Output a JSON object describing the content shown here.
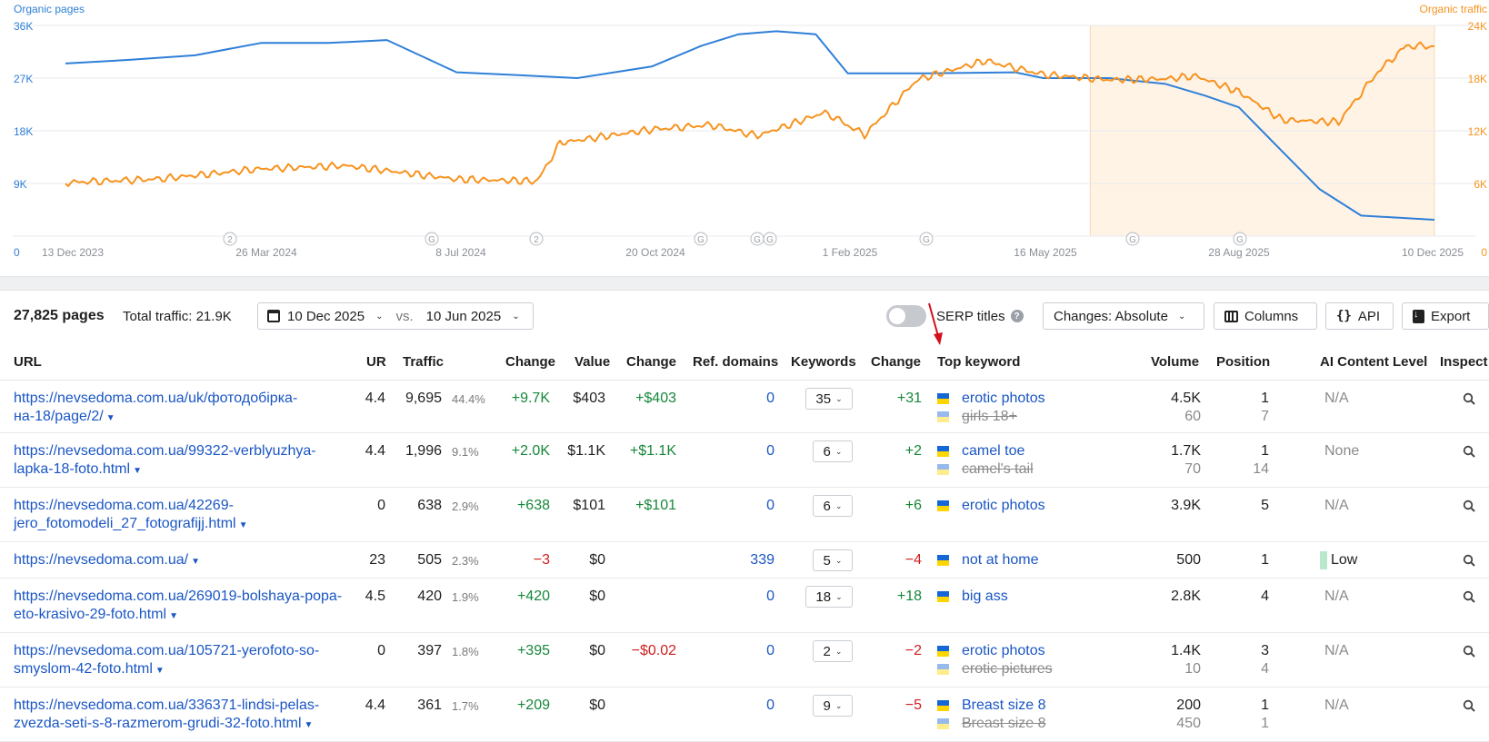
{
  "chart": {
    "left_label": "Organic pages",
    "right_label": "Organic traffic",
    "left_ticks": [
      "36K",
      "27K",
      "18K",
      "9K",
      "0"
    ],
    "right_ticks": [
      "24K",
      "18K",
      "12K",
      "6K",
      "0"
    ],
    "x_ticks": [
      "13 Dec 2023",
      "26 Mar 2024",
      "8 Jul 2024",
      "20 Oct 2024",
      "1 Feb 2025",
      "16 May 2025",
      "28 Aug 2025",
      "10 Dec 2025"
    ],
    "markers": [
      "2",
      "G",
      "2",
      "G",
      "G",
      "G",
      "G",
      "G",
      "G"
    ],
    "colors": {
      "pages": "#2f7fd8",
      "traffic": "#f7931e",
      "highlight": "#fff3e6"
    }
  },
  "chart_data": {
    "type": "line",
    "x_range": [
      "13 Dec 2023",
      "10 Dec 2025"
    ],
    "series": [
      {
        "name": "Organic pages",
        "axis": "left",
        "ylim": [
          0,
          36000
        ],
        "x": [
          "2023-12-13",
          "2024-01-15",
          "2024-02-20",
          "2024-03-26",
          "2024-05-01",
          "2024-06-01",
          "2024-07-08",
          "2024-08-10",
          "2024-09-10",
          "2024-10-20",
          "2024-11-15",
          "2024-12-05",
          "2024-12-25",
          "2025-01-15",
          "2025-02-01",
          "2025-03-15",
          "2025-05-01",
          "2025-05-16",
          "2025-06-20",
          "2025-07-20",
          "2025-08-10",
          "2025-08-28",
          "2025-09-20",
          "2025-10-10",
          "2025-11-01",
          "2025-12-10"
        ],
        "values": [
          29500,
          30100,
          30900,
          33000,
          33000,
          33500,
          28000,
          27500,
          27000,
          29000,
          32500,
          34500,
          35000,
          34500,
          27800,
          27800,
          28000,
          27000,
          27000,
          26000,
          24000,
          22000,
          14500,
          8000,
          3500,
          2800
        ]
      },
      {
        "name": "Organic traffic",
        "axis": "right",
        "ylim": [
          0,
          24000
        ],
        "x": [
          "2023-12-13",
          "2024-02-01",
          "2024-03-26",
          "2024-05-10",
          "2024-07-08",
          "2024-08-20",
          "2024-09-01",
          "2024-10-20",
          "2024-11-20",
          "2024-12-15",
          "2025-01-20",
          "2025-02-10",
          "2025-03-10",
          "2025-04-15",
          "2025-05-16",
          "2025-06-20",
          "2025-07-20",
          "2025-08-05",
          "2025-08-28",
          "2025-09-20",
          "2025-10-20",
          "2025-11-10",
          "2025-11-25",
          "2025-12-10"
        ],
        "values": [
          6100,
          6300,
          7400,
          8000,
          6700,
          6500,
          10700,
          11800,
          12200,
          11300,
          14500,
          12000,
          18100,
          19500,
          17700,
          17500,
          18300,
          19000,
          16800,
          13000,
          12500,
          18300,
          22000,
          22500
        ]
      }
    ]
  },
  "toolbar": {
    "pages": "27,825 pages",
    "total_traffic": "Total traffic: 21.9K",
    "date1": "10 Dec 2025",
    "vs": "vs.",
    "date2": "10 Jun 2025",
    "serp_titles": "SERP titles",
    "changes": "Changes: Absolute",
    "columns": "Columns",
    "api": "API",
    "export": "Export"
  },
  "columns": {
    "url": "URL",
    "ur": "UR",
    "traffic": "Traffic",
    "change1": "Change",
    "value": "Value",
    "change2": "Change",
    "ref": "Ref. domains",
    "keywords": "Keywords",
    "change3": "Change",
    "top_keyword": "Top keyword",
    "volume": "Volume",
    "position": "Position",
    "ai": "AI Content Level",
    "inspect": "Inspect"
  },
  "rows": [
    {
      "url": "https://nevsedoma.com.ua/uk/фотодобірка-на-18/page/2/",
      "ur": "4.4",
      "traffic": "9,695",
      "pct": "44.4%",
      "change": "+9.7K",
      "change_type": "pos",
      "value": "$403",
      "vchange": "+$403",
      "vchange_type": "pos",
      "ref": "0",
      "keywords": "35",
      "kchange": "+31",
      "kchange_type": "pos",
      "kw1": "erotic photos",
      "kw2": "girls 18+",
      "vol1": "4.5K",
      "vol2": "60",
      "pos1": "1",
      "pos2": "7",
      "ai": "N/A"
    },
    {
      "url": "https://nevsedoma.com.ua/99322-verblyuzhya-lapka-18-foto.html",
      "ur": "4.4",
      "traffic": "1,996",
      "pct": "9.1%",
      "change": "+2.0K",
      "change_type": "pos",
      "value": "$1.1K",
      "vchange": "+$1.1K",
      "vchange_type": "pos",
      "ref": "0",
      "keywords": "6",
      "kchange": "+2",
      "kchange_type": "pos",
      "kw1": "camel toe",
      "kw2": "camel's tail",
      "vol1": "1.7K",
      "vol2": "70",
      "pos1": "1",
      "pos2": "14",
      "ai": "None"
    },
    {
      "url": "https://nevsedoma.com.ua/42269-jero_fotomodeli_27_fotografijj.html",
      "ur": "0",
      "traffic": "638",
      "pct": "2.9%",
      "change": "+638",
      "change_type": "pos",
      "value": "$101",
      "vchange": "+$101",
      "vchange_type": "pos",
      "ref": "0",
      "keywords": "6",
      "kchange": "+6",
      "kchange_type": "pos",
      "kw1": "erotic photos",
      "kw2": "",
      "vol1": "3.9K",
      "vol2": "",
      "pos1": "5",
      "pos2": "",
      "ai": "N/A"
    },
    {
      "url": "https://nevsedoma.com.ua/",
      "ur": "23",
      "traffic": "505",
      "pct": "2.3%",
      "change": "−3",
      "change_type": "neg",
      "value": "$0",
      "vchange": "",
      "vchange_type": "pos",
      "ref": "339",
      "keywords": "5",
      "kchange": "−4",
      "kchange_type": "neg",
      "kw1": "not at home",
      "kw2": "",
      "vol1": "500",
      "vol2": "",
      "pos1": "1",
      "pos2": "",
      "ai": "Low"
    },
    {
      "url": "https://nevsedoma.com.ua/269019-bolshaya-popa-eto-krasivo-29-foto.html",
      "ur": "4.5",
      "traffic": "420",
      "pct": "1.9%",
      "change": "+420",
      "change_type": "pos",
      "value": "$0",
      "vchange": "",
      "vchange_type": "pos",
      "ref": "0",
      "keywords": "18",
      "kchange": "+18",
      "kchange_type": "pos",
      "kw1": "big ass",
      "kw2": "",
      "vol1": "2.8K",
      "vol2": "",
      "pos1": "4",
      "pos2": "",
      "ai": "N/A"
    },
    {
      "url": "https://nevsedoma.com.ua/105721-yerofoto-so-smyslom-42-foto.html",
      "ur": "0",
      "traffic": "397",
      "pct": "1.8%",
      "change": "+395",
      "change_type": "pos",
      "value": "$0",
      "vchange": "−$0.02",
      "vchange_type": "neg",
      "ref": "0",
      "keywords": "2",
      "kchange": "−2",
      "kchange_type": "neg",
      "kw1": "erotic photos",
      "kw2": "erotic pictures",
      "vol1": "1.4K",
      "vol2": "10",
      "pos1": "3",
      "pos2": "4",
      "ai": "N/A"
    },
    {
      "url": "https://nevsedoma.com.ua/336371-lindsi-pelas-zvezda-seti-s-8-razmerom-grudi-32-foto.html",
      "ur": "4.4",
      "traffic": "361",
      "pct": "1.7%",
      "change": "+209",
      "change_type": "pos",
      "value": "$0",
      "vchange": "",
      "vchange_type": "pos",
      "ref": "0",
      "keywords": "9",
      "kchange": "−5",
      "kchange_type": "neg",
      "kw1": "Breast size 8",
      "kw2": "Breast size 8",
      "vol1": "200",
      "vol2": "450",
      "pos1": "1",
      "pos2": "1",
      "ai": "N/A"
    }
  ]
}
